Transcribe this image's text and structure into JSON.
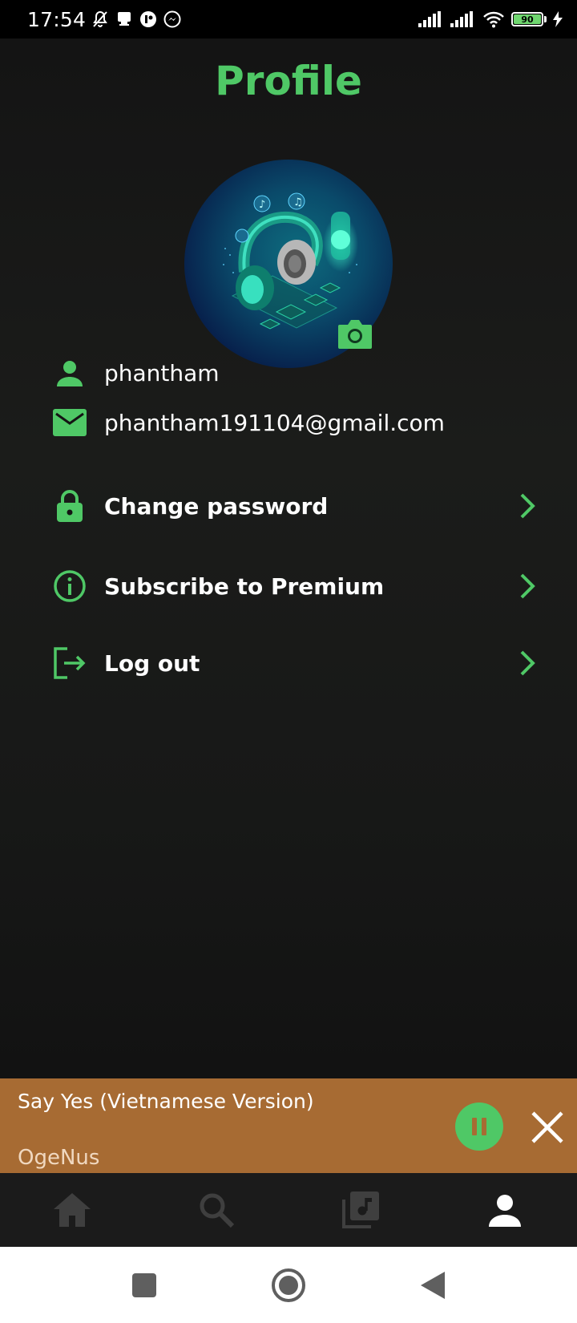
{
  "status_bar": {
    "time": "17:54",
    "battery_level": "90",
    "icons": [
      "bell-off-icon",
      "notification-icon",
      "app-icon",
      "messenger-icon",
      "signal-icon",
      "signal-icon",
      "wifi-icon",
      "battery-icon",
      "charging-icon"
    ]
  },
  "header": {
    "title": "Profile"
  },
  "profile": {
    "username": "phantham",
    "email": "phantham191104@gmail.com",
    "avatar_icon": "headphones-illustration",
    "camera_icon": "camera-icon"
  },
  "menu": {
    "items": [
      {
        "label": "Change password",
        "icon": "lock-icon"
      },
      {
        "label": "Subscribe to Premium",
        "icon": "info-icon"
      },
      {
        "label": "Log out",
        "icon": "logout-icon"
      }
    ]
  },
  "player": {
    "title": "Say Yes (Vietnamese Version)",
    "artist": "OgeNus",
    "state": "playing"
  },
  "nav": {
    "items": [
      {
        "icon": "home-icon",
        "active": false
      },
      {
        "icon": "search-icon",
        "active": false
      },
      {
        "icon": "library-icon",
        "active": false
      },
      {
        "icon": "profile-icon",
        "active": true
      }
    ]
  },
  "colors": {
    "accent": "#4fc866",
    "player_bg": "#a76b33",
    "nav_bg": "#1b1b1b",
    "inactive_icon": "#3f3f3f"
  }
}
